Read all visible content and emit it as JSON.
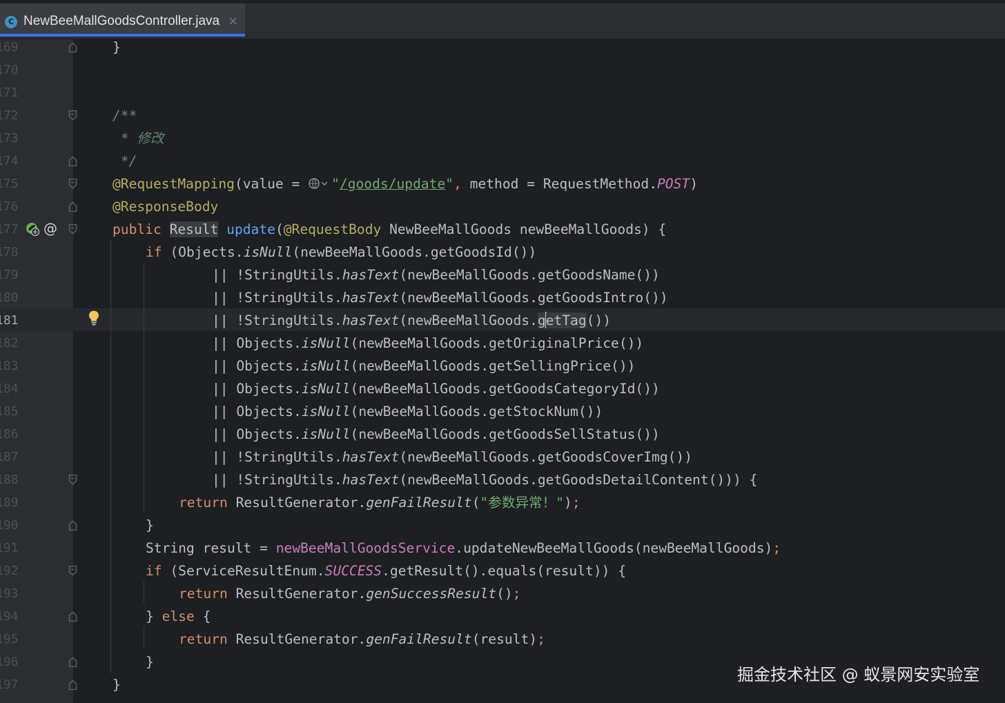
{
  "tab": {
    "title": "NewBeeMallGoodsController.java",
    "file_icon": "C",
    "close_glyph": "×"
  },
  "gutter": {
    "line_numbers": [
      "169",
      "170",
      "171",
      "172",
      "173",
      "174",
      "175",
      "176",
      "177",
      "178",
      "179",
      "180",
      "181",
      "182",
      "183",
      "184",
      "185",
      "186",
      "187",
      "188",
      "189",
      "190",
      "191",
      "192",
      "193",
      "194",
      "195",
      "196",
      "197"
    ],
    "active_line": "181",
    "at_glyph": "@"
  },
  "code": {
    "l169": "}",
    "doc_open": "/**",
    "doc_star": " * ",
    "doc_text": "修改",
    "doc_close": " */",
    "anno_mapping": "@RequestMapping",
    "value_eq": "(value = ",
    "url_q1": "\"",
    "url": "/goods/update",
    "url_q2": "\"",
    "comma": ",",
    "method_eq": " method = RequestMethod.",
    "post": "POST",
    "rparen": ")",
    "anno_body": "@ResponseBody",
    "kw_public": "public",
    "type_result": "Result",
    "method_name": "update",
    "anno_reqbody": "@RequestBody",
    "params": " NewBeeMallGoods newBeeMallGoods) {",
    "kw_if": "if",
    "l178_a": " (Objects.",
    "isnull": "isNull",
    "l178_b": "(newBeeMallGoods.getGoodsId())",
    "or_su": "|| !StringUtils.",
    "hastext": "hasText",
    "or_obj": "|| Objects.",
    "l179": "(newBeeMallGoods.getGoodsName())",
    "l180": "(newBeeMallGoods.getGoodsIntro())",
    "l181_a": "(newBeeMallGoods.",
    "l181_g": "g",
    "l181_e": "e",
    "l181_tag": "tTag",
    "l181_c": "())",
    "l182": "(newBeeMallGoods.getOriginalPrice())",
    "l183": "(newBeeMallGoods.getSellingPrice())",
    "l184": "(newBeeMallGoods.getGoodsCategoryId())",
    "l185": "(newBeeMallGoods.getStockNum())",
    "l186": "(newBeeMallGoods.getGoodsSellStatus())",
    "l187": "(newBeeMallGoods.getGoodsCoverImg())",
    "l188": "(newBeeMallGoods.getGoodsDetailContent())) {",
    "kw_return": "return",
    "rg": " ResultGenerator.",
    "genfail": "genFailResult",
    "lp": "(",
    "fail_msg": "\"参数异常！\"",
    "rp": ")",
    "semi": ";",
    "close_brace": "}",
    "l191_a": "String result = ",
    "service": "newBeeMallGoodsService",
    "l191_b": ".updateNewBeeMallGoods(newBeeMallGoods)",
    "l192_a": " (ServiceResultEnum.",
    "success": "SUCCESS",
    "l192_b": ".getResult().equals(result)) {",
    "gensuccess": "genSuccessResult",
    "empty_call": "()",
    "else_open": "} ",
    "kw_else": "else",
    "else_brace": " {",
    "result_arg": "(result)"
  },
  "watermark": "掘金技术社区 @ 蚁景网安实验室"
}
